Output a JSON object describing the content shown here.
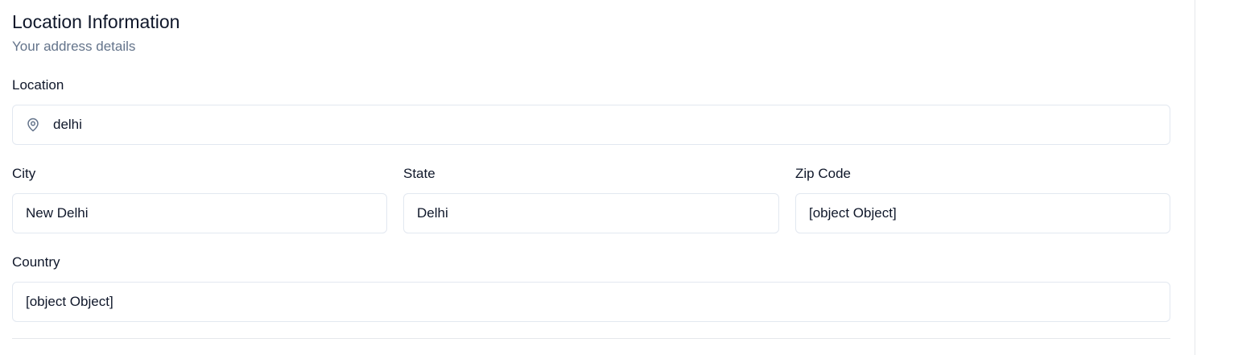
{
  "section": {
    "title": "Location Information",
    "subtitle": "Your address details"
  },
  "location": {
    "label": "Location",
    "value": "delhi",
    "icon": "map-pin-icon"
  },
  "city": {
    "label": "City",
    "value": "New Delhi"
  },
  "state": {
    "label": "State",
    "value": "Delhi"
  },
  "zip": {
    "label": "Zip Code",
    "value": "[object Object]"
  },
  "country": {
    "label": "Country",
    "value": "[object Object]"
  },
  "colors": {
    "text": "#0f172a",
    "muted": "#64748b",
    "border": "#e2e8f0"
  }
}
